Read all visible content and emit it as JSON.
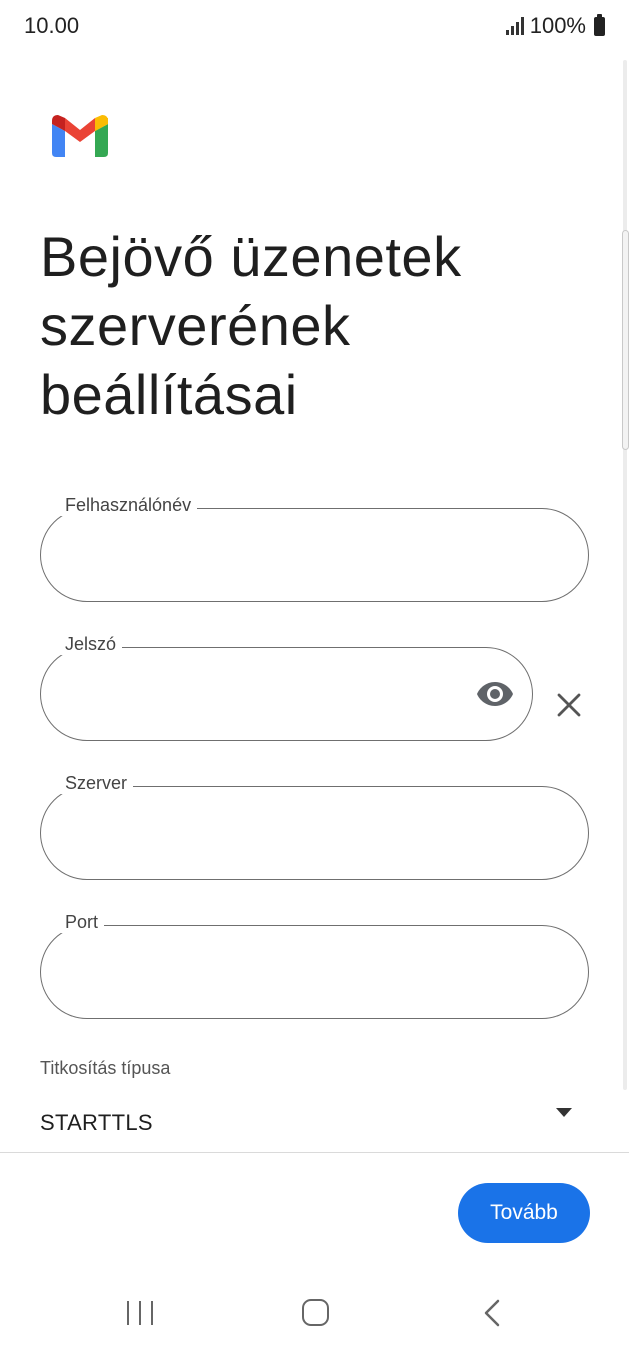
{
  "status_bar": {
    "time": "10.00",
    "battery": "100%"
  },
  "app": {
    "logo_icon": "gmail-logo"
  },
  "page": {
    "title": "Bejövő üzenetek\nszerverének\nbeállításai"
  },
  "form": {
    "username": {
      "label": "Felhasználónév",
      "value": ""
    },
    "password": {
      "label": "Jelszó",
      "value": "",
      "toggle_icon": "eye-icon",
      "clear_icon": "close-icon"
    },
    "server": {
      "label": "Szerver",
      "value": ""
    },
    "port": {
      "label": "Port",
      "value": ""
    },
    "encryption": {
      "label": "Titkosítás típusa",
      "value": "STARTTLS",
      "dropdown_icon": "dropdown-arrow-icon"
    }
  },
  "footer": {
    "next_label": "Tovább",
    "accent_color": "#1a73e8"
  },
  "nav_bar": {
    "icons": [
      "recents-icon",
      "home-icon",
      "back-icon"
    ]
  }
}
